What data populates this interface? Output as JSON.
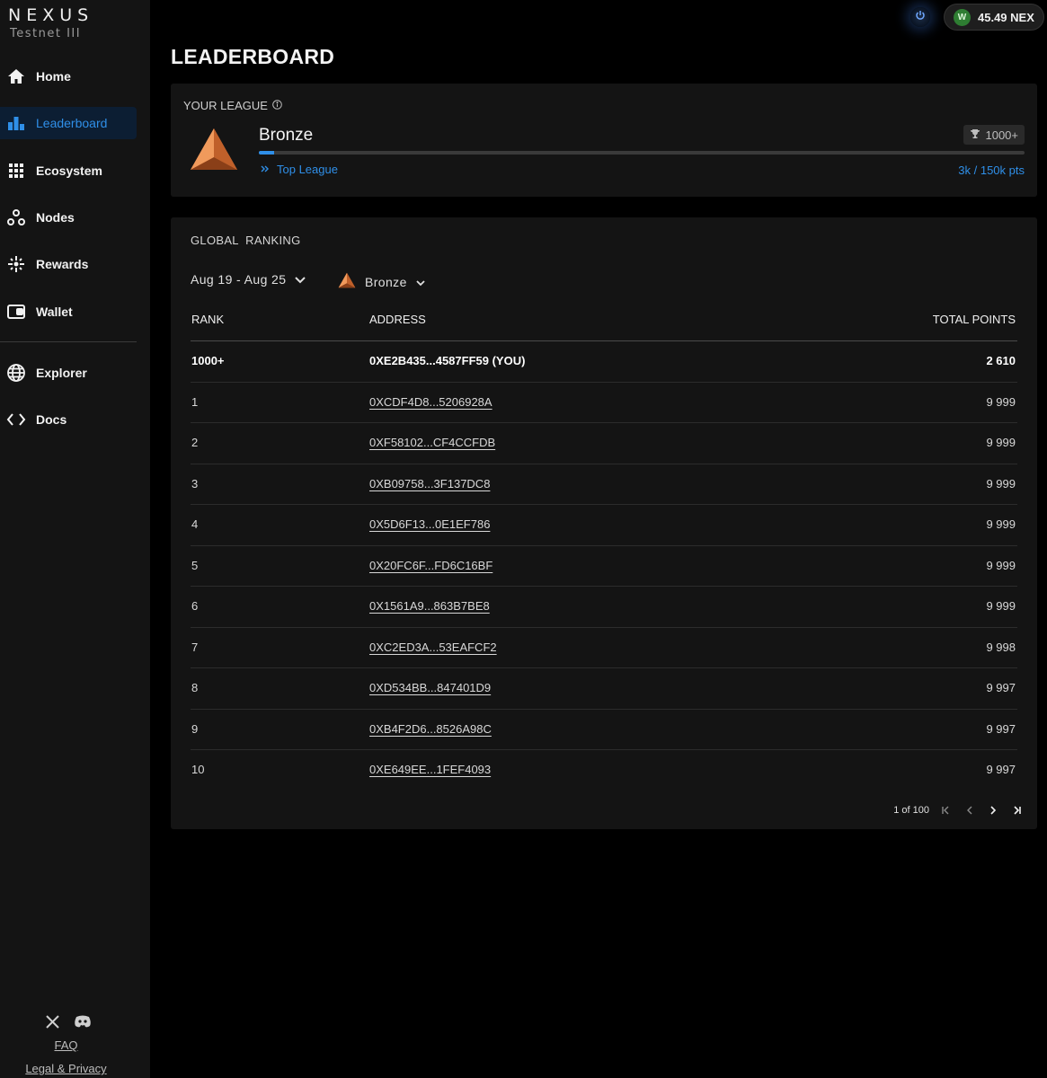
{
  "brand": {
    "title": "NEXUS",
    "subtitle": "Testnet III"
  },
  "sidebar": {
    "items": [
      {
        "label": "Home",
        "icon": "home-icon"
      },
      {
        "label": "Leaderboard",
        "icon": "bar-chart-icon",
        "active": true
      },
      {
        "label": "Ecosystem",
        "icon": "grid-icon"
      },
      {
        "label": "Nodes",
        "icon": "nodes-icon"
      },
      {
        "label": "Rewards",
        "icon": "sparkle-icon"
      },
      {
        "label": "Wallet",
        "icon": "wallet-icon"
      }
    ],
    "secondary": [
      {
        "label": "Explorer",
        "icon": "globe-icon"
      },
      {
        "label": "Docs",
        "icon": "code-icon"
      }
    ],
    "footer": {
      "faq": "FAQ",
      "legal": "Legal & Privacy",
      "social": [
        "x-icon",
        "discord-icon"
      ]
    }
  },
  "topbar": {
    "wallet_initial": "W",
    "balance": "45.49 NEX"
  },
  "page": {
    "title": "LEADERBOARD"
  },
  "league": {
    "label": "YOUR LEAGUE",
    "name": "Bronze",
    "rank_badge": "1000+",
    "progress_fraction": 0.02,
    "top_league_link": "Top League",
    "points": "3k / 150k pts"
  },
  "ranking": {
    "title": "GLOBAL  RANKING",
    "date_filter": "Aug 19 - Aug 25",
    "league_filter": "Bronze",
    "columns": {
      "rank": "RANK",
      "address": "ADDRESS",
      "points": "TOTAL POINTS"
    },
    "you": {
      "rank": "1000+",
      "address": "0XE2B435...4587FF59 (YOU)",
      "points": "2 610"
    },
    "rows": [
      {
        "rank": "1",
        "address": "0XCDF4D8...5206928A",
        "points": "9 999"
      },
      {
        "rank": "2",
        "address": "0XF58102...CF4CCFDB",
        "points": "9 999"
      },
      {
        "rank": "3",
        "address": "0XB09758...3F137DC8",
        "points": "9 999"
      },
      {
        "rank": "4",
        "address": "0X5D6F13...0E1EF786",
        "points": "9 999"
      },
      {
        "rank": "5",
        "address": "0X20FC6F...FD6C16BF",
        "points": "9 999"
      },
      {
        "rank": "6",
        "address": "0X1561A9...863B7BE8",
        "points": "9 999"
      },
      {
        "rank": "7",
        "address": "0XC2ED3A...53EAFCF2",
        "points": "9 998"
      },
      {
        "rank": "8",
        "address": "0XD534BB...847401D9",
        "points": "9 997"
      },
      {
        "rank": "9",
        "address": "0XB4F2D6...8526A98C",
        "points": "9 997"
      },
      {
        "rank": "10",
        "address": "0XE649EE...1FEF4093",
        "points": "9 997"
      }
    ],
    "pagination": {
      "label": "1 of 100"
    }
  },
  "colors": {
    "accent": "#2f8fe8",
    "bronze": "#e07a3c",
    "background": "#000000",
    "panel": "#141414"
  }
}
